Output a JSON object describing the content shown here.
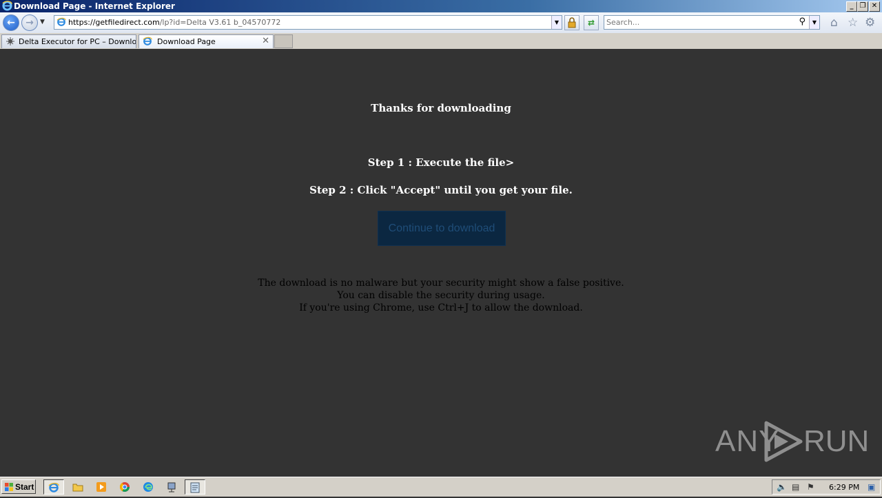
{
  "window": {
    "title": "Download Page - Internet Explorer",
    "controls": {
      "minimize": "_",
      "restore": "❐",
      "close": "✕"
    }
  },
  "navbar": {
    "url_host": "https://getfiledirect.com",
    "url_path": "/lp?id=Delta V3.61 b_04570772",
    "search_placeholder": "Search..."
  },
  "tabs": [
    {
      "label": "Delta Executor for PC – Downlo...",
      "active": false
    },
    {
      "label": "Download Page",
      "active": true
    }
  ],
  "page": {
    "heading": "Thanks for downloading",
    "step1": "Step 1 : Execute the file>",
    "step2": "Step 2 : Click \"Accept\" until you get your file.",
    "button_label": "Continue to download",
    "notice": [
      "The download is no malware but your security might show a false positive.",
      "You can disable the security during usage.",
      "If you're using Chrome, use Ctrl+J to allow the download."
    ]
  },
  "watermark": {
    "left": "ANY",
    "right": "RUN"
  },
  "taskbar": {
    "start_label": "Start",
    "clock": "6:29 PM"
  },
  "colors": {
    "page_background": "#333333",
    "button_background": "#0b2741",
    "button_text": "#1f4d78"
  }
}
